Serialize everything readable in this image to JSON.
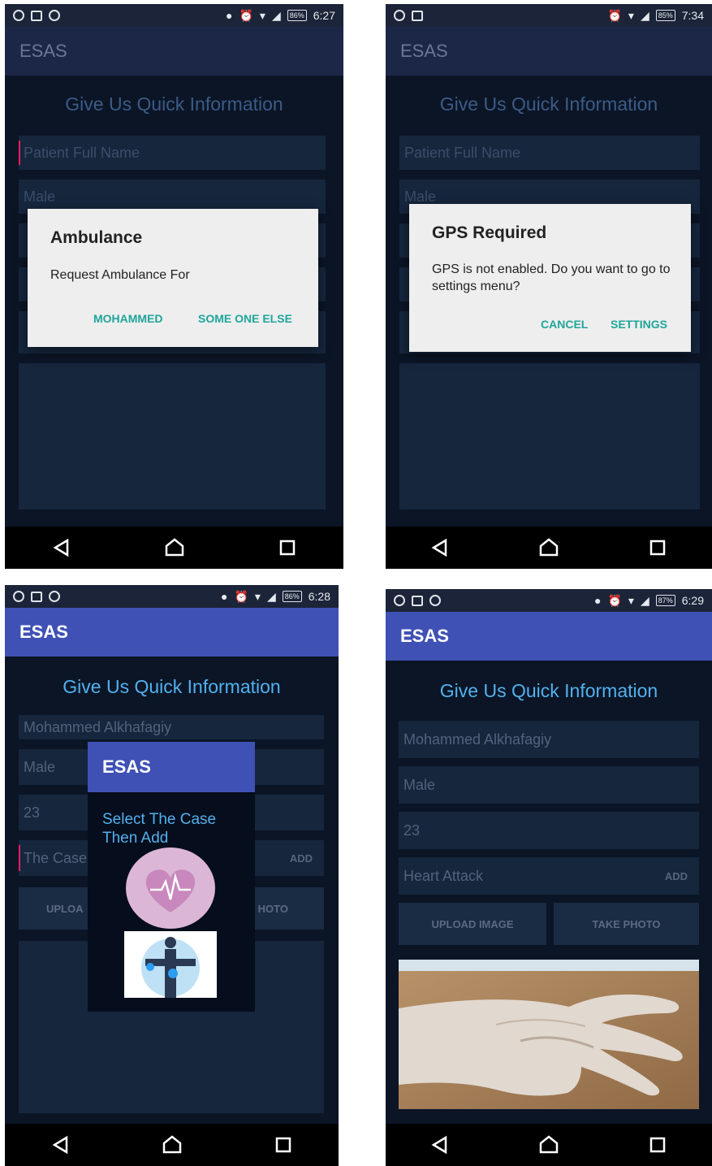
{
  "app_title": "ESAS",
  "heading": "Give Us Quick Information",
  "screen1": {
    "status": {
      "battery": "86%",
      "time": "6:27"
    },
    "fields": {
      "name_placeholder": "Patient Full Name",
      "gender": "Male"
    },
    "dialog": {
      "title": "Ambulance",
      "message": "Request Ambulance For",
      "option1": "MOHAMMED",
      "option2": "SOME ONE ELSE"
    }
  },
  "screen2": {
    "status": {
      "battery": "85%",
      "time": "7:34"
    },
    "fields": {
      "name_placeholder": "Patient Full Name",
      "gender": "Male"
    },
    "dialog": {
      "title": "GPS Required",
      "message": "GPS is not enabled. Do you want to go to settings menu?",
      "cancel": "CANCEL",
      "settings": "SETTINGS"
    }
  },
  "screen3": {
    "status": {
      "battery": "86%",
      "time": "6:28"
    },
    "fields": {
      "name": "Mohammed  Alkhafagiy",
      "gender": "Male",
      "age": "23",
      "case_placeholder": "The Case"
    },
    "add_label": "ADD",
    "upload_partial": "UPLOA",
    "photo_partial": "HOTO",
    "popup": {
      "title": "ESAS",
      "message": "Select The Case Then Add",
      "options": [
        "heart-case-icon",
        "injury-case-icon"
      ]
    }
  },
  "screen4": {
    "status": {
      "battery": "87%",
      "time": "6:29"
    },
    "fields": {
      "name": "Mohammed  Alkhafagiy",
      "gender": "Male",
      "age": "23",
      "case": "Heart Attack"
    },
    "add_label": "ADD",
    "upload_label": "UPLOAD IMAGE",
    "photo_label": "TAKE PHOTO",
    "photo_subject": "hand-photo"
  },
  "colors": {
    "accent": "#3f51b5",
    "heading": "#52b1ee",
    "dialog_button": "#1fa59a",
    "cursor": "#e91e63"
  }
}
